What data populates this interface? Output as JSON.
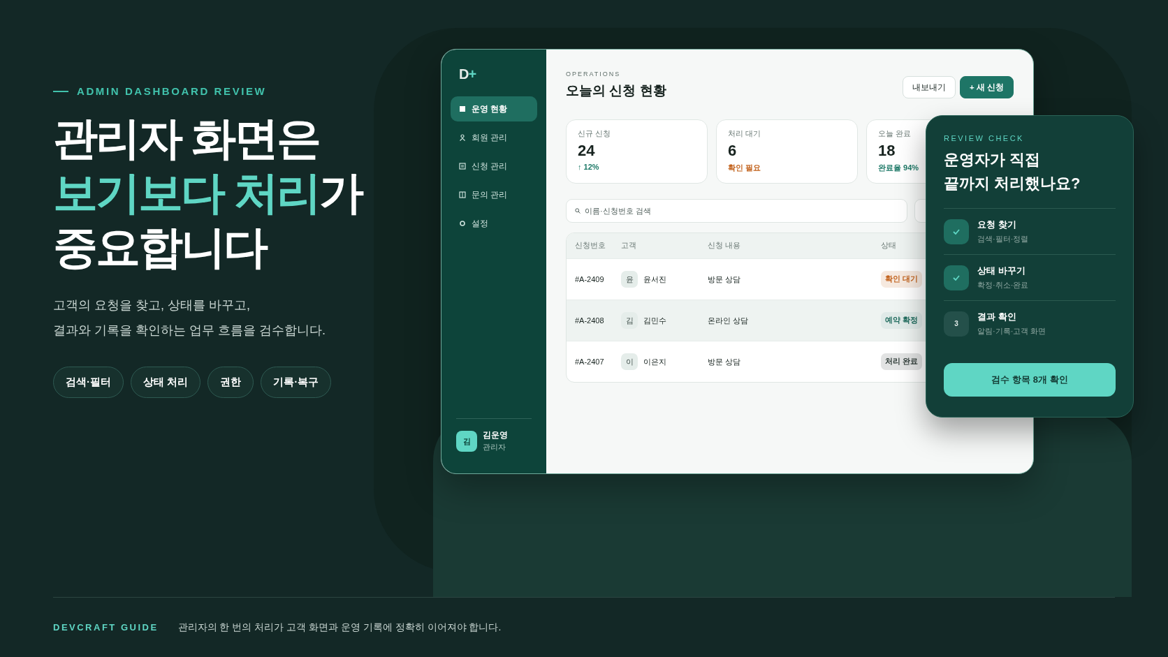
{
  "hero": {
    "eyebrow": "ADMIN DASHBOARD REVIEW",
    "headline": [
      [
        {
          "text": "관리자 화면은",
          "highlight": false
        }
      ],
      [
        {
          "text": "보기보다 처리",
          "highlight": true
        },
        {
          "text": "가",
          "highlight": false
        }
      ],
      [
        {
          "text": "중요합니다",
          "highlight": false
        }
      ]
    ],
    "description": [
      "고객의 요청을 찾고, 상태를 바꾸고,",
      "결과와 기록을 확인하는 업무 흐름을 검수합니다."
    ],
    "chips": [
      "검색·필터",
      "상태 처리",
      "권한",
      "기록·복구"
    ]
  },
  "dashboard": {
    "logo": {
      "letter": "D",
      "mark": "+"
    },
    "nav": [
      {
        "label": "운영 현황",
        "selected": true
      },
      {
        "label": "회원 관리",
        "selected": false
      },
      {
        "label": "신청 관리",
        "selected": false
      },
      {
        "label": "문의 관리",
        "selected": false
      },
      {
        "label": "설정",
        "selected": false
      }
    ],
    "user": {
      "avatar": "김",
      "name": "김운영",
      "role": "관리자"
    },
    "eyebrow": "OPERATIONS",
    "title": "오늘의 신청 현황",
    "buttons": [
      {
        "label": "내보내기",
        "kind": "secondary"
      },
      {
        "label": "+ 새 신청",
        "kind": "primary"
      }
    ],
    "stats": [
      {
        "label": "신규 신청",
        "value": "24",
        "note": "↑ 12%",
        "color": "#1f7a68"
      },
      {
        "label": "처리 대기",
        "value": "6",
        "note": "확인 필요",
        "color": "#c2621c"
      },
      {
        "label": "오늘 완료",
        "value": "18",
        "note": "완료율 94%",
        "color": "#1f7a68"
      }
    ],
    "search": {
      "placeholder": "이름·신청번호 검색"
    },
    "table": {
      "columns": [
        "신청번호",
        "고객",
        "신청 내용",
        "상태"
      ],
      "rows": [
        {
          "id": "#A-2409",
          "avatar": "윤",
          "customer": "윤서진",
          "content": "방문 상담",
          "status": "확인 대기",
          "color": "#c2621c",
          "selected": false
        },
        {
          "id": "#A-2408",
          "avatar": "김",
          "customer": "김민수",
          "content": "온라인 상담",
          "status": "예약 확정",
          "color": "#1e6b5d",
          "selected": true
        },
        {
          "id": "#A-2407",
          "avatar": "이",
          "customer": "이은지",
          "content": "방문 상담",
          "status": "처리 완료",
          "color": "#2d3a36",
          "selected": false
        }
      ]
    }
  },
  "review": {
    "eyebrow": "REVIEW CHECK",
    "title": [
      "운영자가 직접",
      "끝까지 처리했나요?"
    ],
    "items": [
      {
        "label": "요청 찾기",
        "detail": "검색·필터·정렬",
        "done": true
      },
      {
        "label": "상태 바꾸기",
        "detail": "확정·취소·완료",
        "done": true
      },
      {
        "label": "결과 확인",
        "detail": "알림·기록·고객 화면",
        "done": false,
        "number": "3"
      }
    ],
    "button": "검수 항목 8개 확인"
  },
  "footer": {
    "brand": "DEVCRAFT GUIDE",
    "text": "관리자의 한 번의 처리가 고객 화면과 운영 기록에 정확히 이어져야 합니다."
  }
}
